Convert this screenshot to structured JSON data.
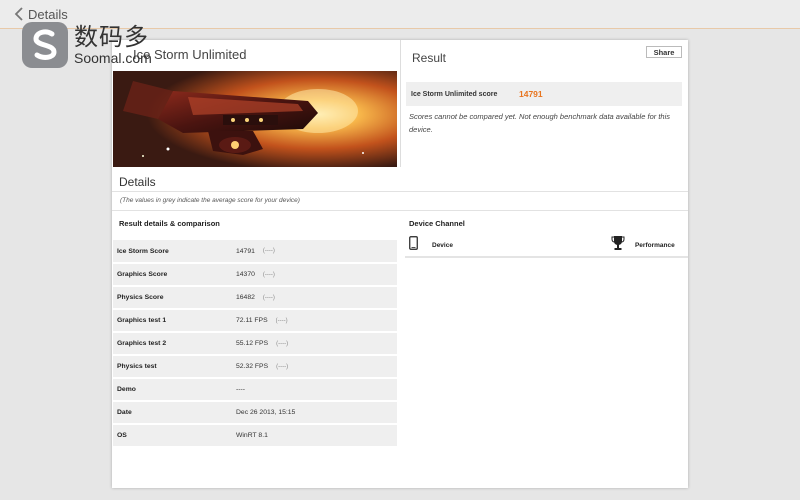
{
  "topbar": {
    "back_label": "Details"
  },
  "watermark": {
    "cn": "数码多",
    "en": "Soomal.com"
  },
  "hero": {
    "title": "Ice Storm Unlimited",
    "image": "spaceship-artwork"
  },
  "result": {
    "title": "Result",
    "share_label": "Share",
    "score_label": "Ice Storm Unlimited score",
    "score_value": "14791",
    "note": "Scores cannot be compared yet. Not enough benchmark data available for this device."
  },
  "details": {
    "title": "Details",
    "note": "(The values in grey indicate the average score for your device)",
    "comparison_title": "Result details & comparison",
    "rows": [
      {
        "key": "Ice Storm Score",
        "value": "14791",
        "avg": "(----)"
      },
      {
        "key": "Graphics Score",
        "value": "14370",
        "avg": "(----)"
      },
      {
        "key": "Physics Score",
        "value": "16482",
        "avg": "(----)"
      },
      {
        "key": "Graphics test 1",
        "value": "72.11 FPS",
        "avg": "(----)"
      },
      {
        "key": "Graphics test 2",
        "value": "55.12 FPS",
        "avg": "(----)"
      },
      {
        "key": "Physics test",
        "value": "52.32 FPS",
        "avg": "(----)"
      },
      {
        "key": "Demo",
        "value": "----",
        "avg": ""
      },
      {
        "key": "Date",
        "value": "Dec 26 2013, 15:15",
        "avg": ""
      },
      {
        "key": "OS",
        "value": "WinRT 8.1",
        "avg": ""
      }
    ]
  },
  "device_channel": {
    "title": "Device Channel",
    "device_label": "Device",
    "performance_label": "Performance",
    "icons": [
      "phone-icon",
      "trophy-icon"
    ]
  },
  "colors": {
    "accent": "#e8741e",
    "row_bg": "#efefef",
    "page_bg": "#e6e6e6"
  }
}
